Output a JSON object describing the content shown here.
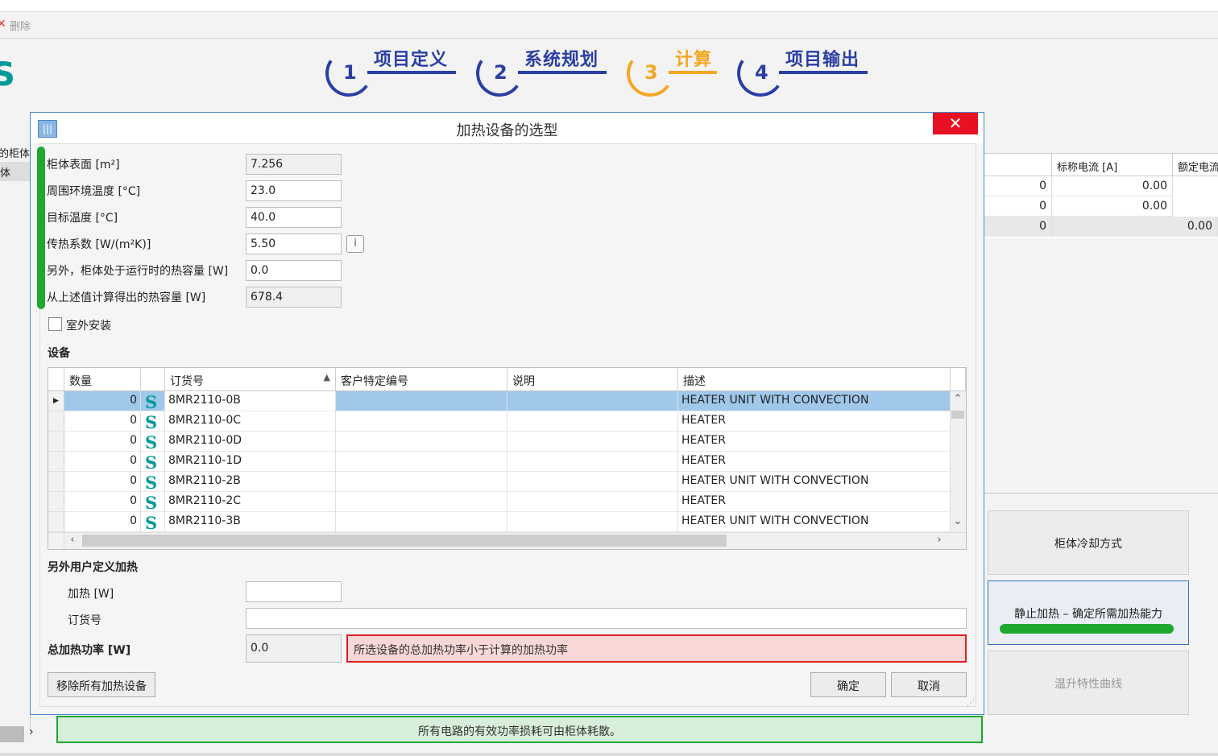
{
  "toolbar": {
    "delete_label": "删除",
    "delete_icon": "x-icon"
  },
  "steps": [
    {
      "num": "1",
      "label": "项目定义"
    },
    {
      "num": "2",
      "label": "系统规划"
    },
    {
      "num": "3",
      "label": "计算",
      "active": true
    },
    {
      "num": "4",
      "label": "项目输出"
    }
  ],
  "left_panel": {
    "frag1": "的柜体",
    "frag2": "体"
  },
  "right_table": {
    "headers": [
      "",
      "标称电流 [A]",
      "额定电流"
    ],
    "rows": [
      [
        "0",
        "0.00"
      ],
      [
        "0",
        "0.00"
      ],
      [
        "0",
        "0.00"
      ]
    ]
  },
  "side_buttons": {
    "cooling": "柜体冷却方式",
    "static_heating": "静止加热 – 确定所需加热能力",
    "curve": "温升特性曲线"
  },
  "status_bar": "所有电路的有效功率损耗可由柜体耗散。",
  "dialog": {
    "title": "加热设备的选型",
    "close": "✕",
    "fields": [
      {
        "label": "柜体表面 [m²]",
        "value": "7.256",
        "readonly": true
      },
      {
        "label": "周围环境温度 [°C]",
        "value": "23.0"
      },
      {
        "label": "目标温度 [°C]",
        "value": "40.0"
      },
      {
        "label": "传热系数 [W/(m²K)]",
        "value": "5.50"
      },
      {
        "label": "另外，柜体处于运行时的热容量 [W]",
        "value": "0.0"
      },
      {
        "label": "从上述值计算得出的热容量 [W]",
        "value": "678.4",
        "readonly": true
      }
    ],
    "outdoor_label": "室外安装",
    "equipment_title": "设备",
    "grid": {
      "headers": [
        "数量",
        "",
        "订货号",
        "客户特定编号",
        "说明",
        "描述"
      ],
      "rows": [
        {
          "qty": "0",
          "order": "8MR2110-0B",
          "cust": "",
          "note": "",
          "desc": "HEATER UNIT WITH CONVECTION",
          "selected": true
        },
        {
          "qty": "0",
          "order": "8MR2110-0C",
          "cust": "",
          "note": "",
          "desc": "HEATER"
        },
        {
          "qty": "0",
          "order": "8MR2110-0D",
          "cust": "",
          "note": "",
          "desc": "HEATER"
        },
        {
          "qty": "0",
          "order": "8MR2110-1D",
          "cust": "",
          "note": "",
          "desc": "HEATER"
        },
        {
          "qty": "0",
          "order": "8MR2110-2B",
          "cust": "",
          "note": "",
          "desc": "HEATER UNIT WITH CONVECTION"
        },
        {
          "qty": "0",
          "order": "8MR2110-2C",
          "cust": "",
          "note": "",
          "desc": "HEATER"
        },
        {
          "qty": "0",
          "order": "8MR2110-3B",
          "cust": "",
          "note": "",
          "desc": "HEATER UNIT WITH CONVECTION"
        }
      ]
    },
    "custom_title": "另外用户定义加热",
    "heating_label": "加热 [W]",
    "heating_value": "",
    "order_label": "订货号",
    "order_value": "",
    "total_label": "总加热功率 [W]",
    "total_value": "0.0",
    "error": "所选设备的总加热功率小于计算的加热功率",
    "remove_btn": "移除所有加热设备",
    "ok_btn": "确定",
    "cancel_btn": "取消"
  },
  "colors": {
    "accent": "#2a3ea5",
    "active_step": "#f5a623",
    "green": "#1ea830",
    "error": "#e02020",
    "brand": "#009999"
  }
}
